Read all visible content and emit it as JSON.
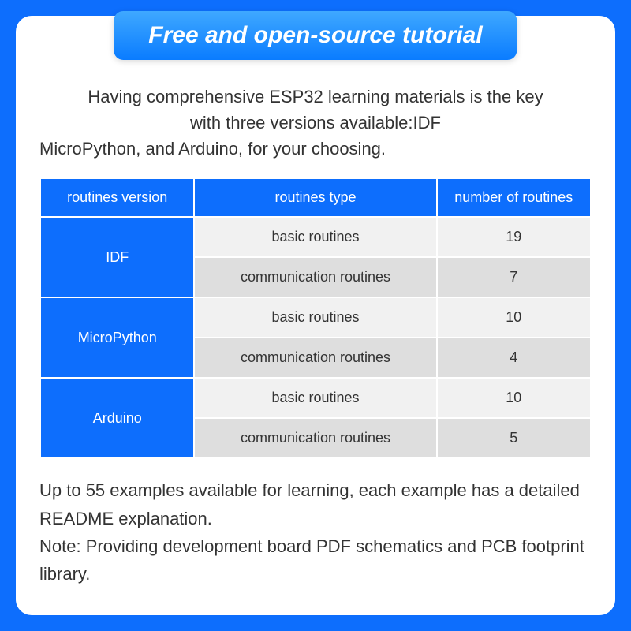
{
  "title": "Free and open-source tutorial",
  "intro_line1": "Having comprehensive ESP32 learning materials is the key",
  "intro_line2": "with three versions available:IDF",
  "intro_line3": "MicroPython, and Arduino, for your choosing.",
  "headers": {
    "version": "routines version",
    "type": "routines type",
    "number": "number of routines"
  },
  "rows": [
    {
      "version": "IDF",
      "type": "basic routines",
      "number": "19",
      "shade": "light"
    },
    {
      "version": "",
      "type": "communication routines",
      "number": "7",
      "shade": "dark"
    },
    {
      "version": "MicroPython",
      "type": "basic routines",
      "number": "10",
      "shade": "light"
    },
    {
      "version": "",
      "type": "communication routines",
      "number": "4",
      "shade": "dark"
    },
    {
      "version": "Arduino",
      "type": "basic routines",
      "number": "10",
      "shade": "light"
    },
    {
      "version": "",
      "type": "communication routines",
      "number": "5",
      "shade": "dark"
    }
  ],
  "footer_line1": "Up to 55 examples available for learning, each example has a detailed README explanation.",
  "footer_line2": "Note: Providing development board PDF schematics and PCB footprint library.",
  "chart_data": {
    "type": "table",
    "title": "Free and open-source tutorial",
    "columns": [
      "routines version",
      "routines type",
      "number of routines"
    ],
    "data": [
      [
        "IDF",
        "basic routines",
        19
      ],
      [
        "IDF",
        "communication routines",
        7
      ],
      [
        "MicroPython",
        "basic routines",
        10
      ],
      [
        "MicroPython",
        "communication routines",
        4
      ],
      [
        "Arduino",
        "basic routines",
        10
      ],
      [
        "Arduino",
        "communication routines",
        5
      ]
    ],
    "total_examples": 55
  }
}
